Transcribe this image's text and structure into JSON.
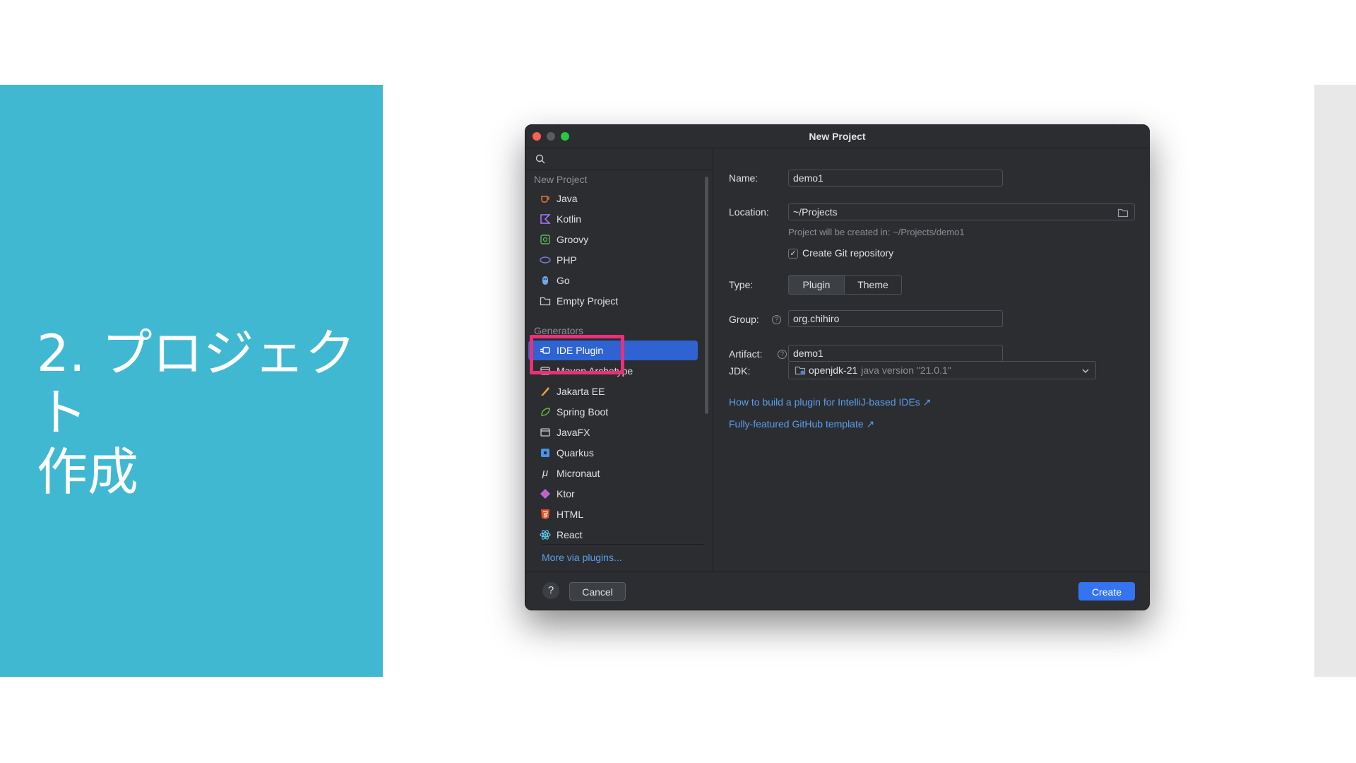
{
  "slide": {
    "title": "2. プロジェクト\n作成",
    "background_color": "#40b8d2",
    "highlight_color": "#ec2f7a"
  },
  "window": {
    "title": "New Project"
  },
  "sidebar": {
    "new_project_header": "New Project",
    "new_project_items": [
      {
        "label": "Java",
        "icon": "java-icon"
      },
      {
        "label": "Kotlin",
        "icon": "kotlin-icon"
      },
      {
        "label": "Groovy",
        "icon": "groovy-icon"
      },
      {
        "label": "PHP",
        "icon": "php-icon"
      },
      {
        "label": "Go",
        "icon": "go-icon"
      },
      {
        "label": "Empty Project",
        "icon": "folder-icon"
      }
    ],
    "generators_header": "Generators",
    "generator_items": [
      {
        "label": "IDE Plugin",
        "icon": "plugin-icon",
        "selected": true
      },
      {
        "label": "Maven Archetype",
        "icon": "maven-icon"
      },
      {
        "label": "Jakarta EE",
        "icon": "jakarta-icon"
      },
      {
        "label": "Spring Boot",
        "icon": "spring-icon"
      },
      {
        "label": "JavaFX",
        "icon": "window-icon"
      },
      {
        "label": "Quarkus",
        "icon": "quarkus-icon"
      },
      {
        "label": "Micronaut",
        "icon": "micronaut-icon"
      },
      {
        "label": "Ktor",
        "icon": "ktor-icon"
      },
      {
        "label": "HTML",
        "icon": "html5-icon"
      },
      {
        "label": "React",
        "icon": "react-icon"
      }
    ],
    "more_plugins": "More via plugins..."
  },
  "form": {
    "name_label": "Name:",
    "name_value": "demo1",
    "location_label": "Location:",
    "location_value": "~/Projects",
    "location_hint": "Project will be created in: ~/Projects/demo1",
    "git_checkbox_label": "Create Git repository",
    "git_checked": true,
    "type_label": "Type:",
    "type_options": [
      "Plugin",
      "Theme"
    ],
    "type_selected": "Plugin",
    "group_label": "Group:",
    "group_value": "org.chihiro",
    "artifact_label": "Artifact:",
    "artifact_value": "demo1",
    "jdk_label": "JDK:",
    "jdk_name": "openjdk-21",
    "jdk_version": "java version \"21.0.1\"",
    "help_glyph": "?",
    "links": [
      "How to build a plugin for IntelliJ-based IDEs ↗",
      "Fully-featured GitHub template ↗"
    ]
  },
  "footer": {
    "help_glyph": "?",
    "cancel_label": "Cancel",
    "create_label": "Create"
  }
}
